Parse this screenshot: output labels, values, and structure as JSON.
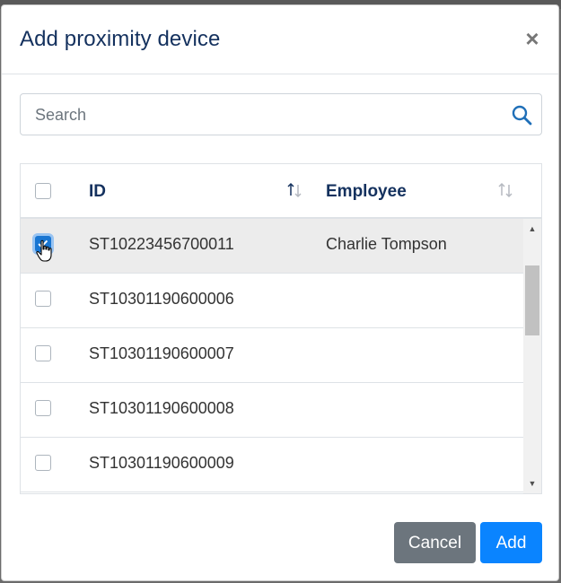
{
  "dialog": {
    "title": "Add proximity device",
    "close_symbol": "×"
  },
  "search": {
    "placeholder": "Search",
    "value": "",
    "icon": "search-icon"
  },
  "table": {
    "columns": [
      {
        "label": "ID",
        "sortable": true
      },
      {
        "label": "Employee",
        "sortable": true
      }
    ],
    "rows": [
      {
        "id": "ST10223456700011",
        "employee": "Charlie Tompson",
        "checked": true
      },
      {
        "id": "ST10301190600006",
        "employee": "",
        "checked": false
      },
      {
        "id": "ST10301190600007",
        "employee": "",
        "checked": false
      },
      {
        "id": "ST10301190600008",
        "employee": "",
        "checked": false
      },
      {
        "id": "ST10301190600009",
        "employee": "",
        "checked": false
      }
    ]
  },
  "footer": {
    "cancel_label": "Cancel",
    "add_label": "Add"
  },
  "colors": {
    "title": "#14315e",
    "primary": "#0a84ff",
    "secondary": "#6c757d",
    "checkbox_checked": "#1976d2"
  }
}
